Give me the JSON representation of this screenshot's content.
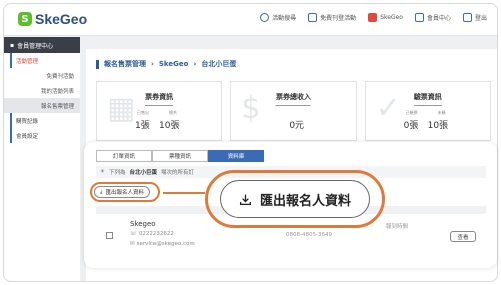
{
  "header": {
    "logo_mark": "S",
    "logo_text": "SkeGeo",
    "nav": [
      {
        "label": "活動搜尋",
        "icon": "search-icon"
      },
      {
        "label": "免費刊登活動",
        "icon": "edit-icon"
      },
      {
        "label": "SkeGeo",
        "icon": "brand-icon"
      },
      {
        "label": "會員中心",
        "icon": "user-icon"
      },
      {
        "label": "登出",
        "icon": "logout-icon"
      }
    ]
  },
  "sidebar": {
    "title": "會員管理中心",
    "items": [
      {
        "label": "活動管理"
      },
      {
        "label": "免費刊活動"
      },
      {
        "label": "我的活動列表"
      },
      {
        "label": "報名售票管理"
      },
      {
        "label": "購買記錄"
      },
      {
        "label": "會員設定"
      }
    ]
  },
  "breadcrumb": [
    "報名售票管理",
    "SkeGeo",
    "台北小巨蛋"
  ],
  "stats": [
    {
      "title": "票券資訊",
      "left_small": "已售出",
      "right_small": "總共",
      "left_value": "1張",
      "right_value": "10張"
    },
    {
      "title": "票券總收入",
      "value": "0元"
    },
    {
      "title": "驗票資訊",
      "left_small": "已驗票",
      "right_small": "未驗",
      "left_value": "0張",
      "right_value": "10張"
    }
  ],
  "tabs": [
    "訂單資訊",
    "票種資訊",
    "資料庫"
  ],
  "tip": {
    "prefix": "下列為",
    "event": "台北小巨蛋",
    "suffix": "場次的所有訂"
  },
  "export_small_label": "匯出報名人資料",
  "export_big_label": "匯出報名人資料",
  "row": {
    "name": "Skegeo",
    "phone": "0222232622",
    "email": "service@skegeo.com",
    "code": "0808-4805-3649",
    "status": "報到時間",
    "view_label": "查看"
  },
  "colors": {
    "accent": "#3a6bb5",
    "highlight": "#e07a3a",
    "brand_green": "#5cbf2a"
  }
}
